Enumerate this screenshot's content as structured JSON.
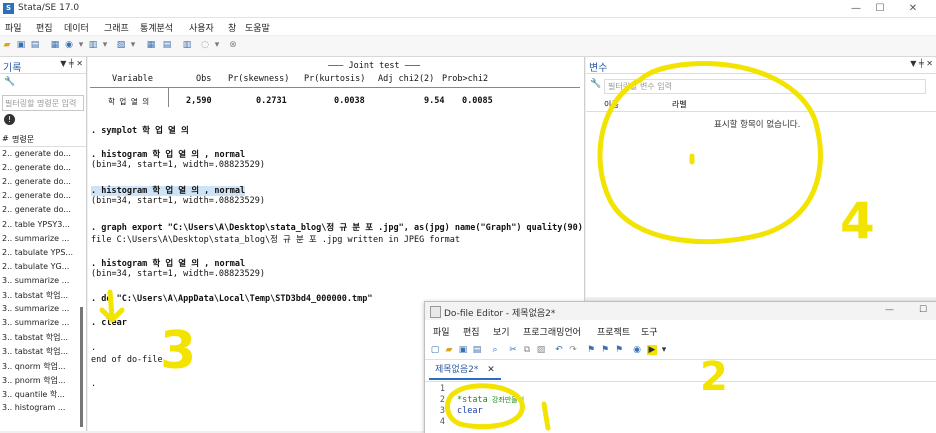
{
  "window": {
    "title": "Stata/SE 17.0",
    "minimize": "—",
    "maximize": "☐",
    "close": "✕"
  },
  "menu": [
    "파일",
    "편집",
    "데이터",
    "그래프",
    "통계분석",
    "사용자",
    "창",
    "도움말"
  ],
  "left_panel": {
    "title": "기록",
    "controls": "▼ ╪ ✕",
    "filter_placeholder": "필터링할 명령문 입력",
    "col_num": "#",
    "col_cmd": "명령문",
    "items": [
      "2.. generate do...",
      "2.. generate do...",
      "2.. generate do...",
      "2.. generate do...",
      "2.. generate do...",
      "2.. table YPSY3...",
      "2.. summarize ...",
      "2.. tabulate YPS...",
      "2.. tabulate YG...",
      "3.. summarize ...",
      "3.. tabstat 학업...",
      "3.. summarize ...",
      "3.. summarize ...",
      "3.. tabstat 학업...",
      "3.. tabstat 학업...",
      "3.. qnorm 학업...",
      "3.. pnorm 학업...",
      "3.. quantile 학...",
      "3.. histogram ..."
    ]
  },
  "results": {
    "joint_test": "——— Joint test ———",
    "headers": [
      "Variable",
      "Obs",
      "Pr(skewness)",
      "Pr(kurtosis)",
      "Adj chi2(2)",
      "Prob>chi2"
    ],
    "row": [
      "학 업 열 의",
      "2,590",
      "0.2731",
      "0.0038",
      "9.54",
      "0.0085"
    ],
    "lines": [
      {
        "text": ". symplot 학 업 열 의",
        "cmd": true
      },
      {
        "text": ". histogram 학 업 열 의 , normal",
        "cmd": true
      },
      {
        "text": "(bin=34, start=1, width=.08823529)",
        "cmd": false
      },
      {
        "text": ". histogram 학 업 열 의 , normal",
        "cmd": true,
        "highlight": true
      },
      {
        "text": "(bin=34, start=1, width=.08823529)",
        "cmd": false
      },
      {
        "text": ". graph export \"C:\\Users\\A\\Desktop\\stata_blog\\정 규 분 포 .jpg\", as(jpg) name(\"Graph\") quality(90)",
        "cmd": true
      },
      {
        "text": "file C:\\Users\\A\\Desktop\\stata_blog\\정 규 분 포 .jpg written in JPEG format",
        "cmd": false
      },
      {
        "text": ". histogram 학 업 열 의 , normal",
        "cmd": true
      },
      {
        "text": "(bin=34, start=1, width=.08823529)",
        "cmd": false
      },
      {
        "text": ". do \"C:\\Users\\A\\AppData\\Local\\Temp\\STD3bd4_000000.tmp\"",
        "cmd": true
      },
      {
        "text": ". clear",
        "cmd": true
      },
      {
        "text": ".",
        "cmd": false
      },
      {
        "text": "end of do-file",
        "cmd": false
      },
      {
        "text": ".",
        "cmd": false
      }
    ]
  },
  "variables": {
    "title": "변수",
    "controls": "▼ ╪ ✕",
    "filter_placeholder": "필터링할 변수 입력",
    "col_name": "이름",
    "col_label": "라벨",
    "empty_text": "표시할 항목이 없습니다."
  },
  "dofile": {
    "title": "Do-file Editor - 제목없음2*",
    "menu": [
      "파일",
      "편집",
      "보기",
      "프로그래밍언어",
      "프로젝트",
      "도구"
    ],
    "tab": "제목없음2*",
    "tab_close": "✕",
    "line_numbers": [
      "1",
      "2",
      "3",
      "4"
    ],
    "code": [
      {
        "text": "",
        "comment": ""
      },
      {
        "text": "*stata",
        "comment": " 강좌만들기"
      },
      {
        "text": "clear",
        "comment": ""
      },
      {
        "text": "",
        "comment": ""
      }
    ]
  },
  "annotations": [
    "2",
    "3",
    "4"
  ],
  "colors": {
    "annotation": "#f2e400",
    "accent": "#2b6cc4",
    "highlight": "#cfe3f7"
  }
}
